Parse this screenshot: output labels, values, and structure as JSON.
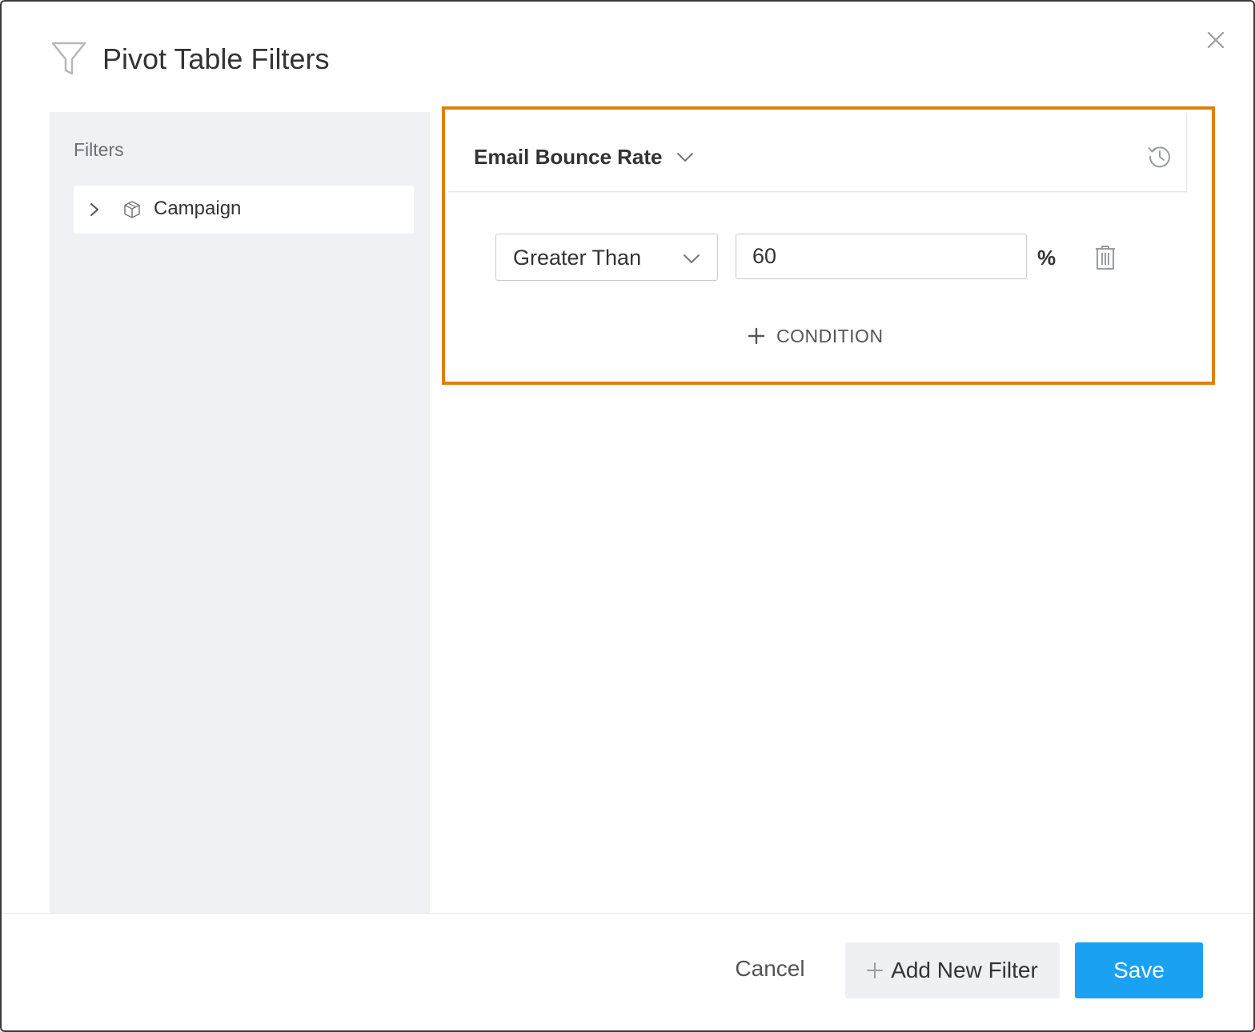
{
  "dialog": {
    "title": "Pivot Table Filters",
    "title_icon": "funnel-icon",
    "close_icon": "close-icon"
  },
  "sidebar": {
    "heading": "Filters",
    "items": [
      {
        "label": "Campaign",
        "expand_icon": "chevron-right-icon",
        "type_icon": "cube-icon"
      }
    ]
  },
  "filter": {
    "metric": "Email Bounce Rate",
    "history_icon": "history-icon",
    "condition": {
      "operator": "Greater Than",
      "value": "60",
      "unit": "%",
      "delete_icon": "trash-icon"
    },
    "add_condition_label": "CONDITION"
  },
  "footer": {
    "cancel_label": "Cancel",
    "add_filter_label": "Add New Filter",
    "save_label": "Save"
  },
  "colors": {
    "highlight": "#e07f0c",
    "primary": "#1ba1f2",
    "sidebar_bg": "#f0f1f4"
  }
}
